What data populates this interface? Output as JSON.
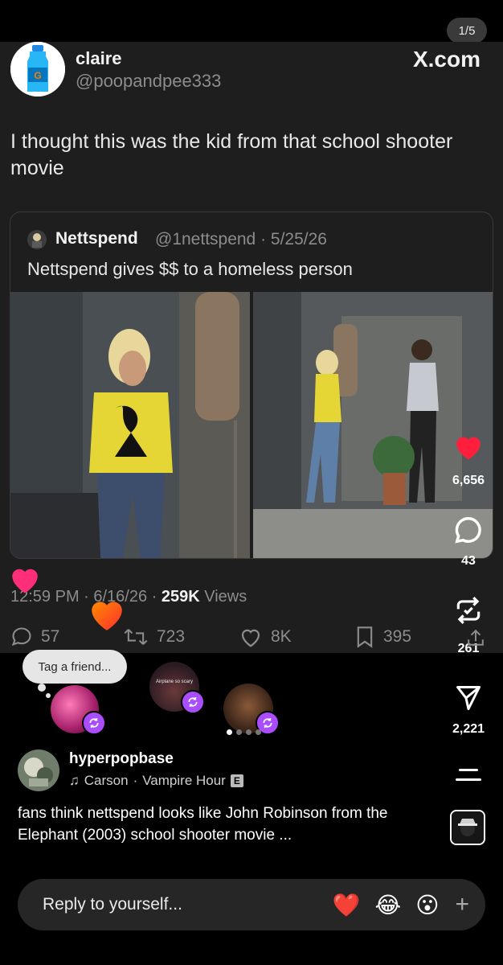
{
  "story_counter": "1/5",
  "tweet": {
    "display_name": "claire",
    "handle": "@poopandpee333",
    "site": "X.com",
    "text": "I thought this was the kid from that school shooter movie",
    "quote": {
      "name": "Nettspend",
      "meta": "@1nettspend · 5/25/26",
      "text": "Nettspend gives $$ to a homeless person"
    },
    "timestamp": "12:59 PM · 6/16/26 · ",
    "views_count": "259K",
    "views_label": " Views",
    "actions": {
      "replies": "57",
      "retweets": "723",
      "likes": "8K",
      "bookmarks": "395"
    }
  },
  "overlay": {
    "tag_friend": "Tag a friend...",
    "story_caption": "Airplane so scary",
    "like_count": "6,656",
    "comment_count": "43",
    "repost_count": "261",
    "share_count": "2,221"
  },
  "post": {
    "creator": "hyperpopbase",
    "music_artist": "Carson",
    "music_track": "Vampire Hour",
    "music_sep": " · ",
    "explicit": "E",
    "caption": "fans think nettspend looks like John Robinson from the Elephant (2003) school shooter movie ..."
  },
  "reply": {
    "placeholder": "Reply to yourself...",
    "emojis": [
      "❤️",
      "😂",
      "😮"
    ],
    "plus": "+"
  },
  "colors": {
    "like_red": "#ff1f3d",
    "repost_purple": "#a94dff",
    "card_bg": "#1e1e1e"
  }
}
